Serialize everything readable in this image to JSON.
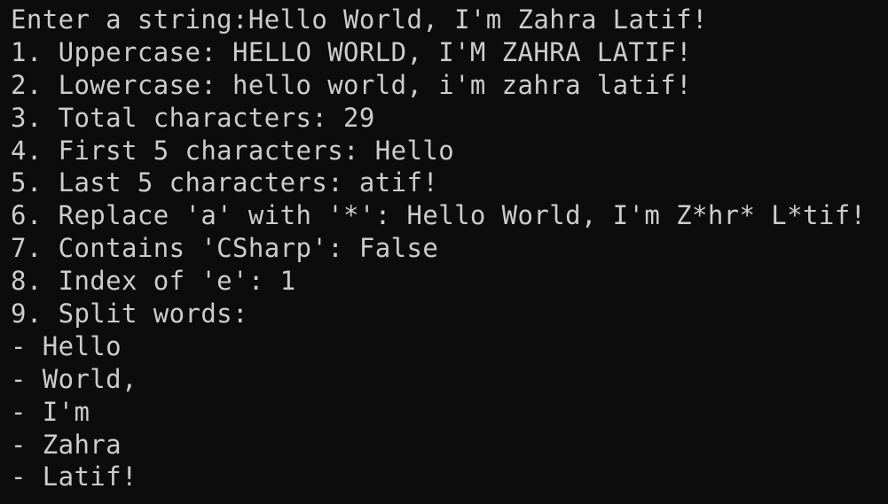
{
  "console": {
    "lines": [
      "Enter a string:Hello World, I'm Zahra Latif!",
      "1. Uppercase: HELLO WORLD, I'M ZAHRA LATIF!",
      "2. Lowercase: hello world, i'm zahra latif!",
      "3. Total characters: 29",
      "4. First 5 characters: Hello",
      "5. Last 5 characters: atif!",
      "6. Replace 'a' with '*': Hello World, I'm Z*hr* L*tif!",
      "7. Contains 'CSharp': False",
      "8. Index of 'e': 1",
      "9. Split words:",
      "- Hello",
      "- World,",
      "- I'm",
      "- Zahra",
      "- Latif!"
    ]
  },
  "colors": {
    "background": "#0c0c0c",
    "text": "#cccccc"
  }
}
